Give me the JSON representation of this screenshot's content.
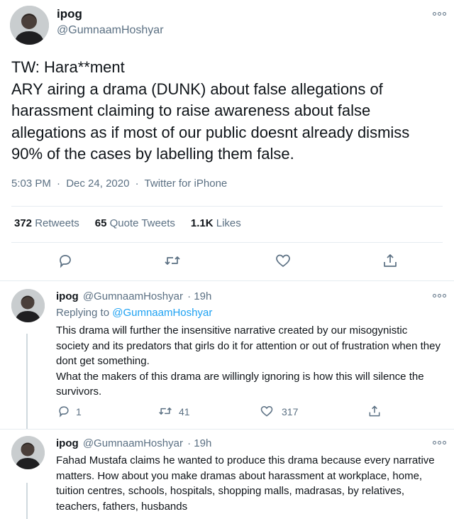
{
  "main_tweet": {
    "display_name": "ipog",
    "handle": "@GumnaamHoshyar",
    "text": "TW: Hara**ment\nARY airing a drama (DUNK) about false allegations of harassment claiming to raise awareness about false allegations as if most of our public doesnt already dismiss 90% of the cases by labelling them false.",
    "time": "5:03 PM",
    "date": "Dec 24, 2020",
    "source": "Twitter for iPhone",
    "sep": "·",
    "stats": {
      "retweets_count": "372",
      "retweets_label": "Retweets",
      "quotes_count": "65",
      "quotes_label": "Quote Tweets",
      "likes_count": "1.1K",
      "likes_label": "Likes"
    }
  },
  "replies": [
    {
      "display_name": "ipog",
      "handle": "@GumnaamHoshyar",
      "age": "· 19h",
      "replying_prefix": "Replying to",
      "replying_to": "@GumnaamHoshyar",
      "paragraph1": "This drama will further the insensitive narrative created by our misogynistic society and its predators that girls do it for attention or out of frustration when they dont get something.",
      "paragraph2": "What the makers of this drama are willingly ignoring is how this will silence the survivors.",
      "reply_count": "1",
      "retweet_count": "41",
      "like_count": "317"
    },
    {
      "display_name": "ipog",
      "handle": "@GumnaamHoshyar",
      "age": "· 19h",
      "text": "Fahad Mustafa claims he wanted to produce this drama because every narrative matters. How about you make dramas about harassment at workplace, home, tuition centres, schools, hospitals, shopping malls, madrasas, by relatives, teachers, fathers, husbands"
    }
  ],
  "colors": {
    "secondary_text": "#5b7083",
    "link": "#1da1f2",
    "divider": "#e6ecf0"
  },
  "icons": [
    "more-icon",
    "reply-icon",
    "retweet-icon",
    "like-icon",
    "share-icon"
  ]
}
